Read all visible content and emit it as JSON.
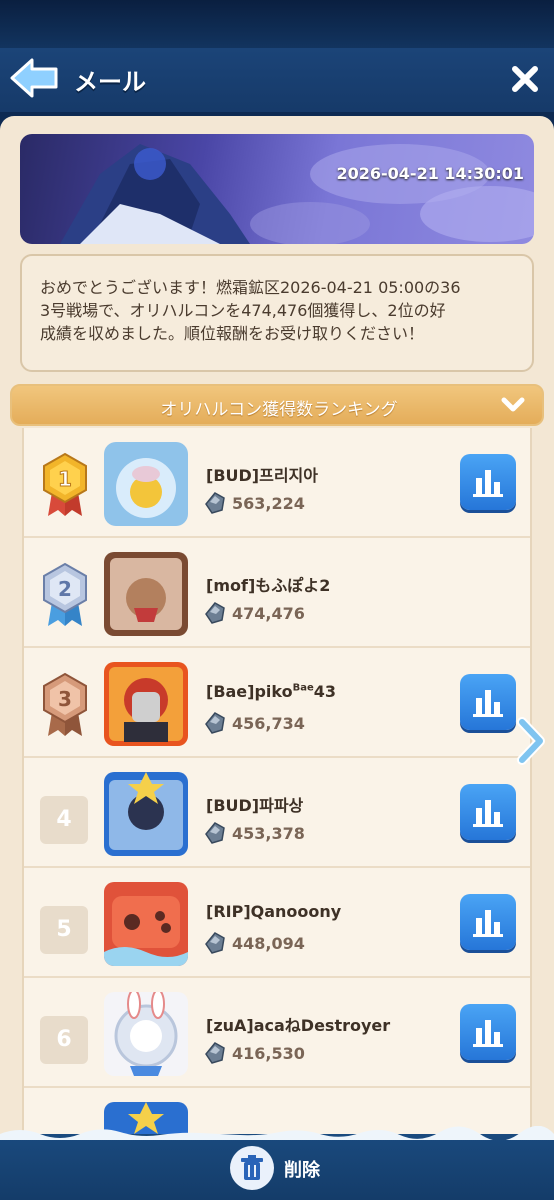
{
  "header": {
    "title": "メール"
  },
  "banner": {
    "date": "2026-04-21 14:30:01"
  },
  "message": {
    "lines": [
      "おめでとうございます！燃霜鉱区2026-04-21 05:00の36",
      "3号戦場で、オリハルコンを474,476個獲得し、2位の好",
      "成績を収めました。順位報酬をお受け取りください！"
    ]
  },
  "ranking": {
    "title": "オリハルコン獲得数ランキング",
    "rows": [
      {
        "rank": "1",
        "name": "[BUD]프리지아",
        "score": "563,224"
      },
      {
        "rank": "2",
        "name": "[mof]もふぽよ2",
        "score": "474,476"
      },
      {
        "rank": "3",
        "name_main": "[Bae]piko",
        "name_sup": "Bae",
        "name_tail": "43",
        "score": "456,734"
      },
      {
        "rank": "4",
        "name": "[BUD]파파상",
        "score": "453,378"
      },
      {
        "rank": "5",
        "name": "[RIP]Qanooony",
        "score": "448,094"
      },
      {
        "rank": "6",
        "name": "[zuA]acaねDestroyer",
        "score": "416,530"
      }
    ]
  },
  "footer": {
    "delete_label": "削除"
  },
  "colors": {
    "accent_blue": "#2676d8",
    "gold": "#e4ad5a",
    "paper": "#f3e7d4"
  },
  "icons": [
    "back-arrow-icon",
    "close-icon",
    "chevron-down-icon",
    "ore-icon",
    "bar-chart-icon",
    "trash-icon",
    "chevron-right-icon"
  ]
}
